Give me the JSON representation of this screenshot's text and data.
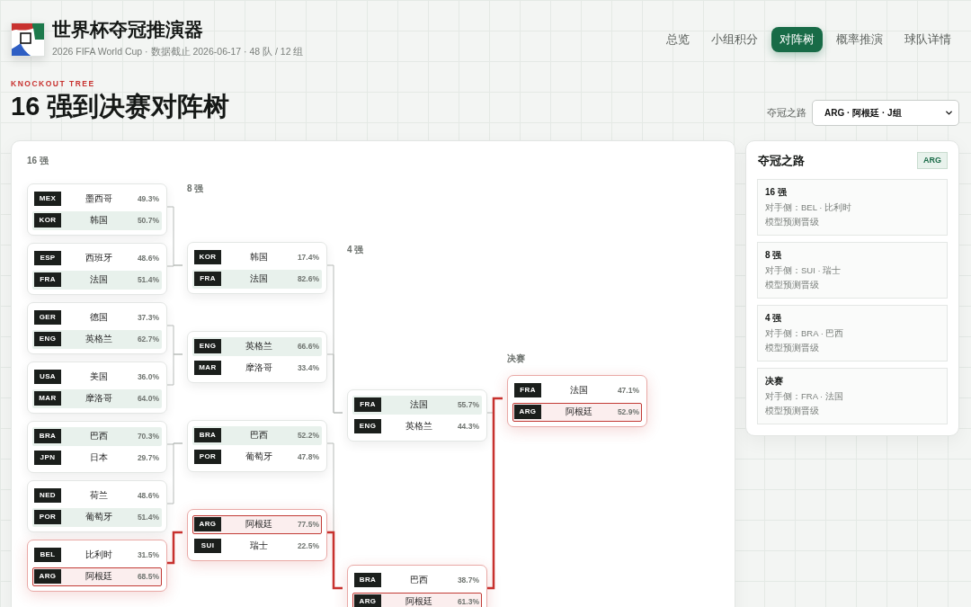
{
  "header": {
    "title": "世界杯夺冠推演器",
    "subtitle": "2026 FIFA World Cup · 数据截止 2026-06-17 · 48 队 / 12 组"
  },
  "nav": [
    {
      "label": "总览",
      "selected": false
    },
    {
      "label": "小组积分",
      "selected": false
    },
    {
      "label": "对阵树",
      "selected": true
    },
    {
      "label": "概率推演",
      "selected": false
    },
    {
      "label": "球队详情",
      "selected": false
    }
  ],
  "section": {
    "eyebrow": "KNOCKOUT TREE",
    "title": "16 强到决赛对阵树"
  },
  "team_picker": {
    "label": "夺冠之路",
    "value": "ARG · 阿根廷 · J组"
  },
  "bracket": {
    "rounds": [
      {
        "label": "16 强",
        "matches": [
          {
            "teams": [
              {
                "code": "MEX",
                "name": "墨西哥",
                "probability": "49.3%",
                "advances": false,
                "on_path": false
              },
              {
                "code": "KOR",
                "name": "韩国",
                "probability": "50.7%",
                "advances": true,
                "on_path": false
              }
            ]
          },
          {
            "teams": [
              {
                "code": "ESP",
                "name": "西班牙",
                "probability": "48.6%",
                "advances": false,
                "on_path": false
              },
              {
                "code": "FRA",
                "name": "法国",
                "probability": "51.4%",
                "advances": true,
                "on_path": false
              }
            ]
          },
          {
            "teams": [
              {
                "code": "GER",
                "name": "德国",
                "probability": "37.3%",
                "advances": false,
                "on_path": false
              },
              {
                "code": "ENG",
                "name": "英格兰",
                "probability": "62.7%",
                "advances": true,
                "on_path": false
              }
            ]
          },
          {
            "teams": [
              {
                "code": "USA",
                "name": "美国",
                "probability": "36.0%",
                "advances": false,
                "on_path": false
              },
              {
                "code": "MAR",
                "name": "摩洛哥",
                "probability": "64.0%",
                "advances": true,
                "on_path": false
              }
            ]
          },
          {
            "teams": [
              {
                "code": "BRA",
                "name": "巴西",
                "probability": "70.3%",
                "advances": true,
                "on_path": false
              },
              {
                "code": "JPN",
                "name": "日本",
                "probability": "29.7%",
                "advances": false,
                "on_path": false
              }
            ]
          },
          {
            "teams": [
              {
                "code": "NED",
                "name": "荷兰",
                "probability": "48.6%",
                "advances": false,
                "on_path": false
              },
              {
                "code": "POR",
                "name": "葡萄牙",
                "probability": "51.4%",
                "advances": true,
                "on_path": false
              }
            ]
          },
          {
            "teams": [
              {
                "code": "BEL",
                "name": "比利时",
                "probability": "31.5%",
                "advances": false,
                "on_path": false
              },
              {
                "code": "ARG",
                "name": "阿根廷",
                "probability": "68.5%",
                "advances": true,
                "on_path": true
              }
            ]
          }
        ]
      },
      {
        "label": "8 强",
        "matches": [
          {
            "teams": [
              {
                "code": "KOR",
                "name": "韩国",
                "probability": "17.4%",
                "advances": false,
                "on_path": false
              },
              {
                "code": "FRA",
                "name": "法国",
                "probability": "82.6%",
                "advances": true,
                "on_path": false
              }
            ]
          },
          {
            "teams": [
              {
                "code": "ENG",
                "name": "英格兰",
                "probability": "66.6%",
                "advances": true,
                "on_path": false
              },
              {
                "code": "MAR",
                "name": "摩洛哥",
                "probability": "33.4%",
                "advances": false,
                "on_path": false
              }
            ]
          },
          {
            "teams": [
              {
                "code": "BRA",
                "name": "巴西",
                "probability": "52.2%",
                "advances": true,
                "on_path": false
              },
              {
                "code": "POR",
                "name": "葡萄牙",
                "probability": "47.8%",
                "advances": false,
                "on_path": false
              }
            ]
          },
          {
            "teams": [
              {
                "code": "ARG",
                "name": "阿根廷",
                "probability": "77.5%",
                "advances": true,
                "on_path": true
              },
              {
                "code": "SUI",
                "name": "瑞士",
                "probability": "22.5%",
                "advances": false,
                "on_path": false
              }
            ]
          }
        ]
      },
      {
        "label": "4 强",
        "matches": [
          {
            "teams": [
              {
                "code": "FRA",
                "name": "法国",
                "probability": "55.7%",
                "advances": true,
                "on_path": false
              },
              {
                "code": "ENG",
                "name": "英格兰",
                "probability": "44.3%",
                "advances": false,
                "on_path": false
              }
            ]
          },
          {
            "teams": [
              {
                "code": "BRA",
                "name": "巴西",
                "probability": "38.7%",
                "advances": false,
                "on_path": false
              },
              {
                "code": "ARG",
                "name": "阿根廷",
                "probability": "61.3%",
                "advances": true,
                "on_path": true
              }
            ]
          }
        ]
      },
      {
        "label": "决赛",
        "matches": [
          {
            "teams": [
              {
                "code": "FRA",
                "name": "法国",
                "probability": "47.1%",
                "advances": false,
                "on_path": false
              },
              {
                "code": "ARG",
                "name": "阿根廷",
                "probability": "52.9%",
                "advances": true,
                "on_path": true
              }
            ]
          }
        ]
      }
    ]
  },
  "path_panel": {
    "title": "夺冠之路",
    "badge": "ARG",
    "steps": [
      {
        "round": "16 强",
        "opponent": "对手侧：BEL · 比利时",
        "result": "模型预测晋级"
      },
      {
        "round": "8 强",
        "opponent": "对手侧：SUI · 瑞士",
        "result": "模型预测晋级"
      },
      {
        "round": "4 强",
        "opponent": "对手侧：BRA · 巴西",
        "result": "模型预测晋级"
      },
      {
        "round": "决赛",
        "opponent": "对手侧：FRA · 法国",
        "result": "模型预测晋级"
      }
    ]
  }
}
